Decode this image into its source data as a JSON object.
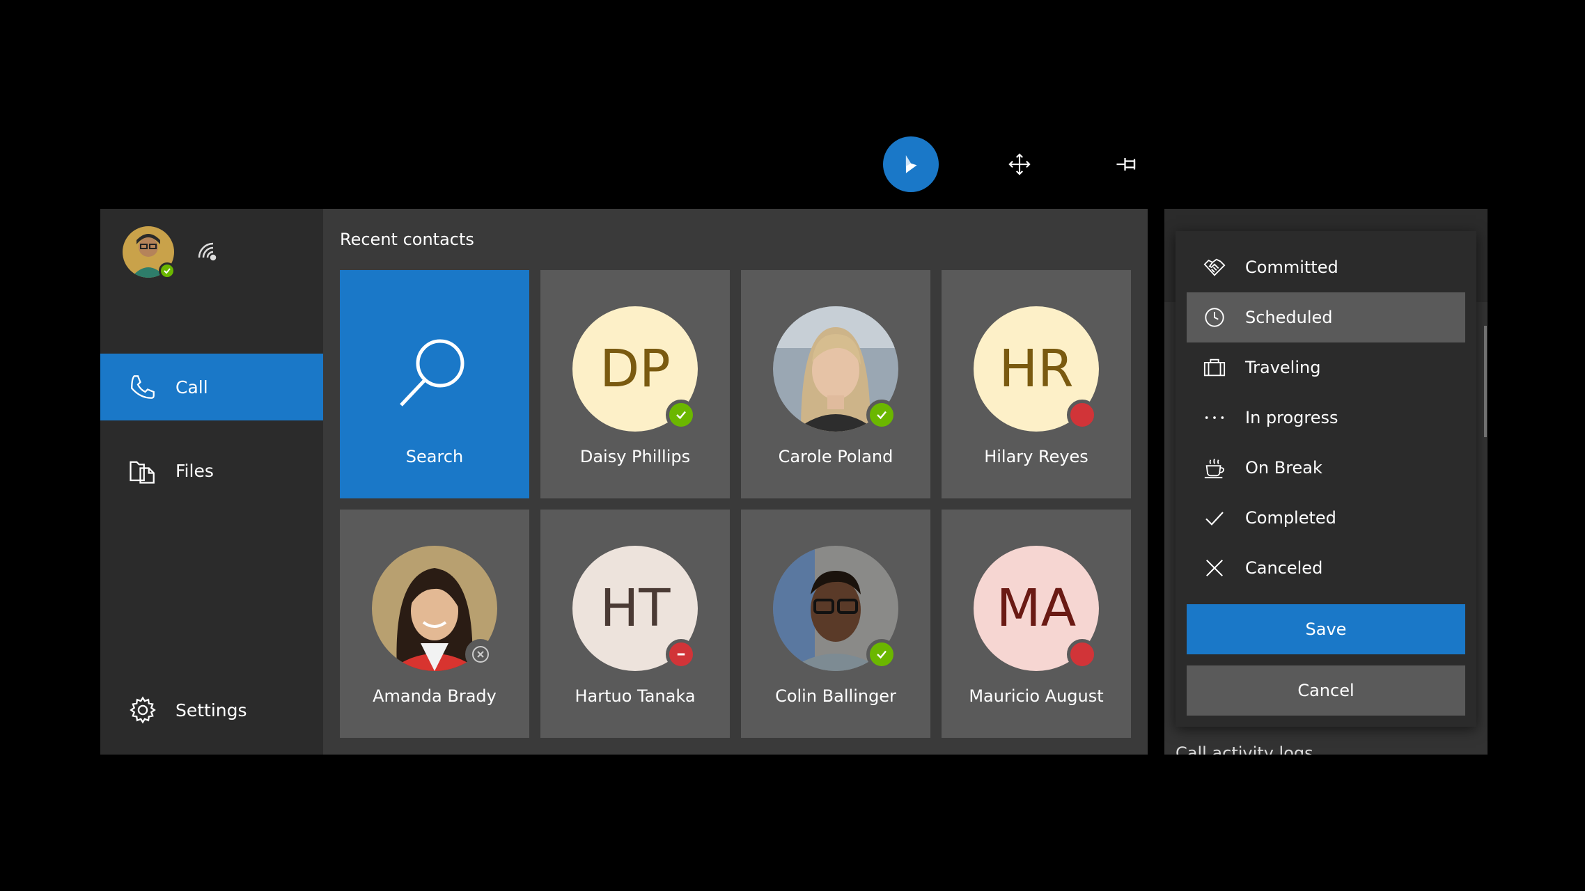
{
  "toolbar": {
    "icons": [
      "dynamics-icon",
      "move-icon",
      "pin-icon"
    ],
    "accent": "#1a78c8"
  },
  "nav": {
    "user_presence": "available",
    "items": [
      {
        "label": "Call",
        "icon": "phone-icon",
        "active": true
      },
      {
        "label": "Files",
        "icon": "files-icon",
        "active": false
      },
      {
        "label": "Settings",
        "icon": "gear-icon",
        "active": false
      }
    ]
  },
  "contacts": {
    "title": "Recent contacts",
    "search_label": "Search",
    "items": [
      {
        "name": "Daisy Phillips",
        "initials": "DP",
        "presence": "available",
        "avatar_bg": "#fdf0c8",
        "initials_color": "#7a5a10"
      },
      {
        "name": "Carole Poland",
        "initials": "",
        "presence": "available",
        "photo": true
      },
      {
        "name": "Hilary Reyes",
        "initials": "HR",
        "presence": "busy",
        "avatar_bg": "#fdf0c8",
        "initials_color": "#7a5a10"
      },
      {
        "name": "Amanda Brady",
        "initials": "",
        "presence": "offline",
        "photo": true
      },
      {
        "name": "Hartuo Tanaka",
        "initials": "HT",
        "presence": "do-not-disturb",
        "avatar_bg": "#ede3dc",
        "initials_color": "#4a3a34"
      },
      {
        "name": "Colin Ballinger",
        "initials": "",
        "presence": "available",
        "photo": true
      },
      {
        "name": "Mauricio August",
        "initials": "MA",
        "presence": "busy",
        "avatar_bg": "#f6d6d2",
        "initials_color": "#6a1a14"
      }
    ]
  },
  "status_menu": {
    "items": [
      {
        "label": "Committed",
        "icon": "handshake-icon",
        "selected": false
      },
      {
        "label": "Scheduled",
        "icon": "clock-icon",
        "selected": true
      },
      {
        "label": "Traveling",
        "icon": "suitcase-icon",
        "selected": false
      },
      {
        "label": "In progress",
        "icon": "more-dots-icon",
        "selected": false
      },
      {
        "label": "On Break",
        "icon": "coffee-icon",
        "selected": false
      },
      {
        "label": "Completed",
        "icon": "checkmark-icon",
        "selected": false
      },
      {
        "label": "Canceled",
        "icon": "close-icon",
        "selected": false
      }
    ],
    "save_label": "Save",
    "cancel_label": "Cancel"
  },
  "right_panel": {
    "footer_label": "Call activity logs"
  }
}
